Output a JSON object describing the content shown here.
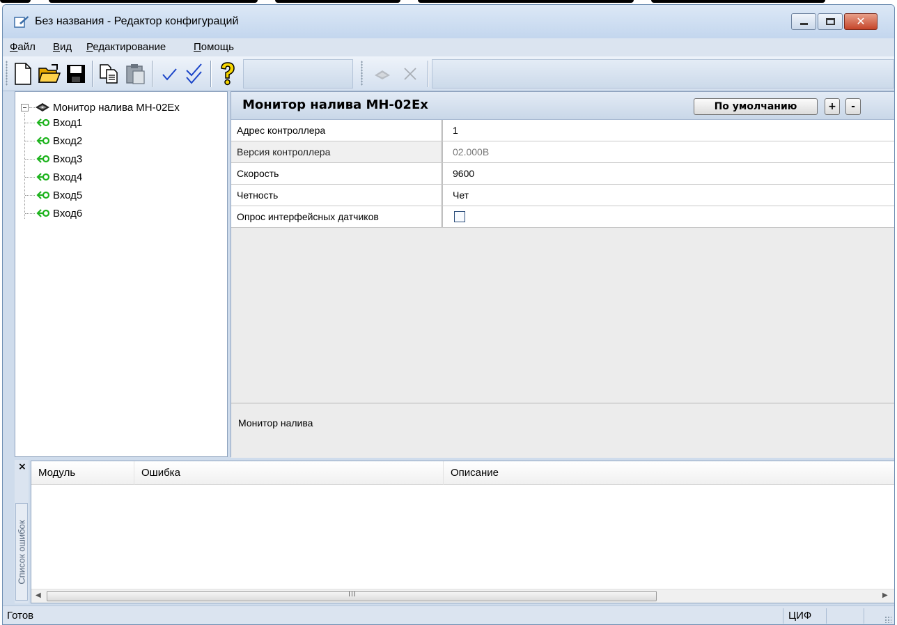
{
  "window": {
    "title": "Без названия - Редактор конфигураций",
    "close_glyph": "✕"
  },
  "menu": {
    "items": [
      {
        "label": "Файл"
      },
      {
        "label": "Вид"
      },
      {
        "label": "Редактирование"
      },
      {
        "label": "Помощь"
      }
    ]
  },
  "toolbar": {
    "icons": [
      "new-file-icon",
      "open-folder-icon",
      "save-icon",
      "copy-icon",
      "paste-icon",
      "check-icon",
      "check-all-icon",
      "help-icon",
      "add-module-icon",
      "delete-icon"
    ]
  },
  "tree": {
    "root": {
      "label": "Монитор налива МН-02Ex"
    },
    "children": [
      {
        "label": "Вход1"
      },
      {
        "label": "Вход2"
      },
      {
        "label": "Вход3"
      },
      {
        "label": "Вход4"
      },
      {
        "label": "Вход5"
      },
      {
        "label": "Вход6"
      }
    ]
  },
  "properties": {
    "title": "Монитор налива МН-02Ex",
    "default_button": "По умолчанию",
    "plus_button": "+",
    "minus_button": "-",
    "rows": [
      {
        "name": "Адрес контроллера",
        "value": "1"
      },
      {
        "name": "Версия контроллера",
        "value": "02.000B"
      },
      {
        "name": "Скорость",
        "value": "9600"
      },
      {
        "name": "Четность",
        "value": "Чет"
      },
      {
        "name": "Опрос интерфейсных датчиков",
        "checked": false
      }
    ],
    "description": "Монитор налива"
  },
  "errors": {
    "close_glyph": "×",
    "tab_label": "Список ошибок",
    "columns": [
      "Модуль",
      "Ошибка",
      "Описание"
    ],
    "scroll_thumb_glyph": "III"
  },
  "status": {
    "text": "Готов",
    "mode": "ЦИФ"
  },
  "colors": {
    "accent_green": "#1db31d",
    "checkmark_blue": "#1a44c8",
    "help_yellow": "#f7d600"
  }
}
